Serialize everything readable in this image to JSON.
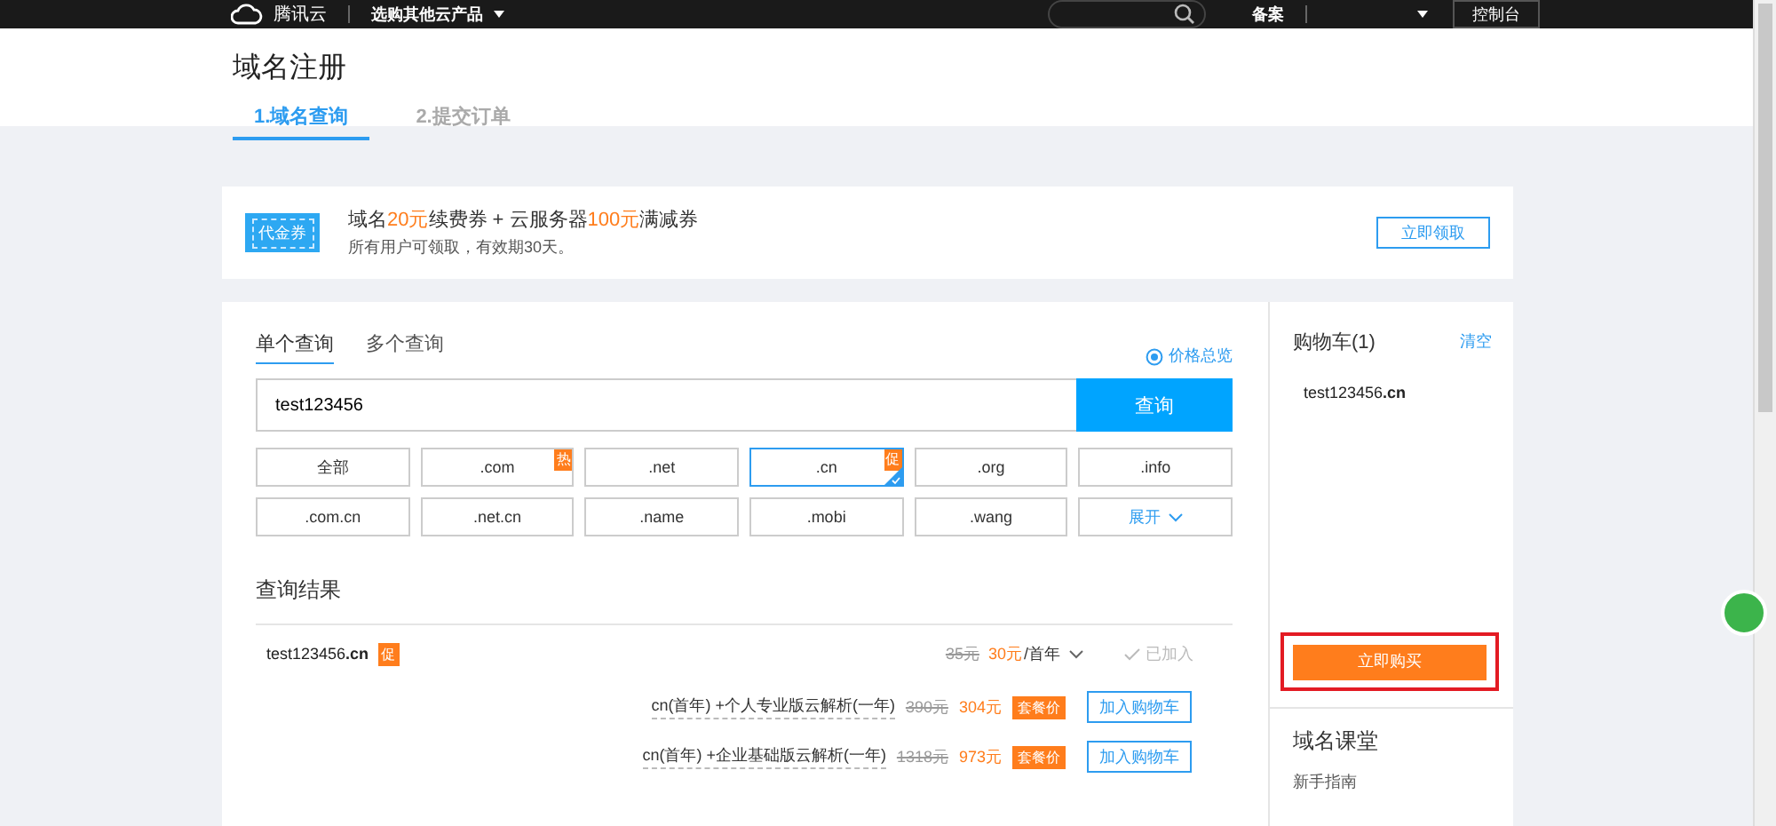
{
  "topbar": {
    "logo_text": "腾讯云",
    "product_menu": "选购其他云产品",
    "links": [
      "备案"
    ],
    "console_button": "控制台"
  },
  "page": {
    "title": "域名注册",
    "steps": [
      {
        "label": "1.域名查询",
        "selected": true
      },
      {
        "label": "2.提交订单",
        "selected": false
      }
    ]
  },
  "promo": {
    "badge": "代金券",
    "headline": [
      {
        "text": "域名",
        "highlight": false
      },
      {
        "text": "20元",
        "highlight": true
      },
      {
        "text": "续费券 + 云服务器",
        "highlight": false
      },
      {
        "text": "100元",
        "highlight": true
      },
      {
        "text": "满减券",
        "highlight": false
      }
    ],
    "note": "所有用户可领取，有效期30天。",
    "button": "立即领取"
  },
  "search": {
    "tabs": [
      {
        "label": "单个查询",
        "selected": true
      },
      {
        "label": "多个查询",
        "selected": false
      }
    ],
    "price_link": "价格总览",
    "value": "test123456",
    "button": "查询",
    "suffixes": [
      {
        "label": "全部",
        "selected": false
      },
      {
        "label": ".com",
        "badge": "热",
        "selected": false
      },
      {
        "label": ".net",
        "selected": false
      },
      {
        "label": ".cn",
        "badge": "促",
        "selected": true
      },
      {
        "label": ".org",
        "selected": false
      },
      {
        "label": ".info",
        "selected": false
      },
      {
        "label": ".com.cn",
        "selected": false
      },
      {
        "label": ".net.cn",
        "selected": false
      },
      {
        "label": ".name",
        "selected": false
      },
      {
        "label": ".mobi",
        "selected": false
      },
      {
        "label": ".wang",
        "selected": false
      }
    ],
    "expand": "展开"
  },
  "results": {
    "title": "查询结果",
    "domain": "test123456**.cn**",
    "badge": "促",
    "old_price": "35元",
    "price": "30元",
    "unit": "/首年",
    "status": "已加入",
    "bundles": [
      {
        "name": "cn(首年) +个人专业版云解析(一年)",
        "old_price": "390元",
        "price": "304元",
        "tag": "套餐价",
        "button": "加入购物车"
      },
      {
        "name": "cn(首年) +企业基础版云解析(一年)",
        "old_price": "1318元",
        "price": "973元",
        "tag": "套餐价",
        "button": "加入购物车"
      }
    ]
  },
  "cart": {
    "title": "购物车(1)",
    "clear": "清空",
    "items": [
      "test123456**.cn**"
    ],
    "buy": "立即购买",
    "buy_highlighted": true
  },
  "course": {
    "title": "域名课堂",
    "links": [
      "新手指南"
    ]
  }
}
